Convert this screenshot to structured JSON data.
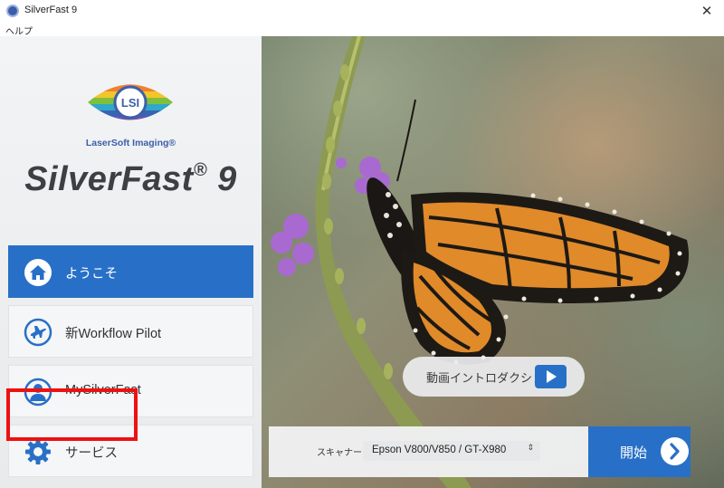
{
  "window": {
    "title": "SilverFast 9",
    "close_glyph": "✕"
  },
  "menu": {
    "help": "ヘルプ"
  },
  "brand": {
    "logo_text": "LSI",
    "company": "LaserSoft Imaging®",
    "product_name": "SilverFast",
    "product_reg": "®",
    "product_version": "9"
  },
  "nav": [
    {
      "label": "ようこそ",
      "icon": "home-icon",
      "active": true
    },
    {
      "label": "新Workflow Pilot",
      "icon": "airplane-icon",
      "active": false
    },
    {
      "label": "MySilverFast",
      "icon": "user-icon",
      "active": false
    },
    {
      "label": "サービス",
      "icon": "gear-icon",
      "active": false
    }
  ],
  "intro": {
    "label": "動画イントロダクション",
    "icon": "play-icon"
  },
  "scanner": {
    "label": "スキャナー",
    "selected": "Epson V800/V850 / GT-X980",
    "arrow": "⇕"
  },
  "start": {
    "label": "開始",
    "icon": "chevron-right-icon"
  },
  "colors": {
    "accent": "#2870c7",
    "highlight": "#ee1111",
    "brand_blue": "#3d5fa8"
  }
}
